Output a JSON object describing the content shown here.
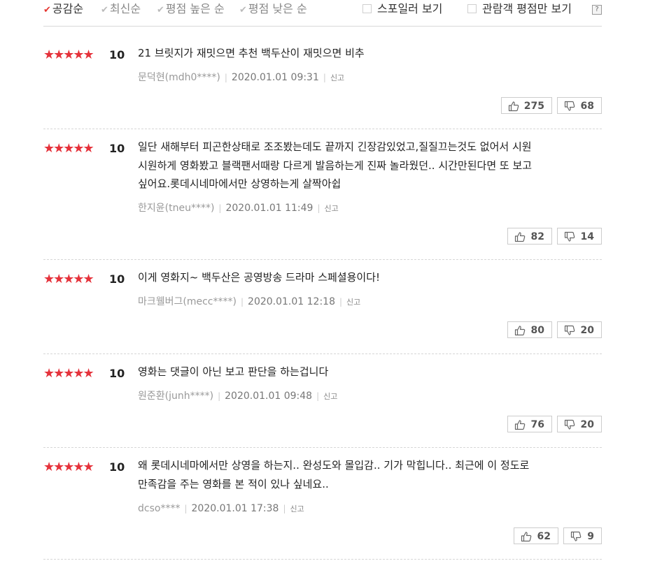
{
  "sort": {
    "options": [
      {
        "label": "공감순",
        "active": true
      },
      {
        "label": "최신순",
        "active": false
      },
      {
        "label": "평점 높은 순",
        "active": false
      },
      {
        "label": "평점 낮은 순",
        "active": false
      }
    ],
    "check_icon": "✔"
  },
  "filters": {
    "spoiler_label": "스포일러 보기",
    "audience_label": "관람객 평점만 보기",
    "help_label": "?"
  },
  "icons": {
    "star": "★★★★★",
    "thumbs_up": "thumbs-up-icon",
    "thumbs_down": "thumbs-down-icon"
  },
  "colors": {
    "star": "#e5323b",
    "active_check": "#e5352f"
  },
  "reviews": [
    {
      "stars": "★★★★★",
      "score": "10",
      "text": "21 브릿지가 재밋으면 추천 백두산이 재밋으면 비추",
      "author": "문덕현(mdh0****)",
      "date": "2020.01.01 09:31",
      "report": "신고",
      "likes": "275",
      "dislikes": "68"
    },
    {
      "stars": "★★★★★",
      "score": "10",
      "text": "일단 새해부터 피곤한상태로 조조봤는데도 끝까지 긴장감있었고,질질끄는것도 없어서 시원\n시원하게 영화봤고 블랙팬서때랑 다르게 발음하는게 진짜 놀라웠던.. 시간만된다면 또 보고\n싶어요.롯데시네마에서만 상영하는게 살짝아쉽",
      "author": "한지윤(tneu****)",
      "date": "2020.01.01 11:49",
      "report": "신고",
      "likes": "82",
      "dislikes": "14"
    },
    {
      "stars": "★★★★★",
      "score": "10",
      "text": "이게 영화지~ 백두산은 공영방송 드라마 스페셜용이다!",
      "author": "마크웰버그(mecc****)",
      "date": "2020.01.01 12:18",
      "report": "신고",
      "likes": "80",
      "dislikes": "20"
    },
    {
      "stars": "★★★★★",
      "score": "10",
      "text": "영화는 댓글이 아닌 보고 판단을 하는겁니다",
      "author": "원준환(junh****)",
      "date": "2020.01.01 09:48",
      "report": "신고",
      "likes": "76",
      "dislikes": "20"
    },
    {
      "stars": "★★★★★",
      "score": "10",
      "text": "왜 롯데시네마에서만 상영을 하는지.. 완성도와 몰입감.. 기가 막힙니다.. 최근에 이 정도로\n만족감을 주는 영화를 본 적이 있나 싶네요..",
      "author": "dcso****",
      "date": "2020.01.01 17:38",
      "report": "신고",
      "likes": "62",
      "dislikes": "9"
    }
  ]
}
